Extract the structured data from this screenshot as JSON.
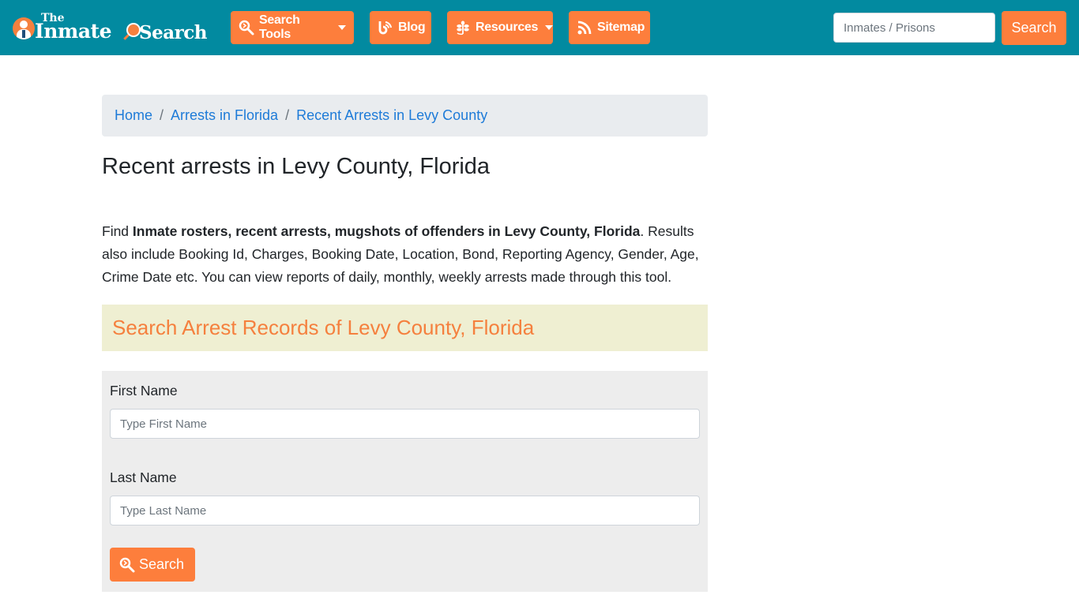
{
  "brand": {
    "logo_the": "The",
    "logo_inmate": "Inmate",
    "logo_search": "Search"
  },
  "nav": {
    "items": [
      {
        "label": "Search Tools",
        "icon": "search-tools-icon",
        "dropdown": true
      },
      {
        "label": "Blog",
        "icon": "blog-icon",
        "dropdown": false
      },
      {
        "label": "Resources",
        "icon": "leaf-icon",
        "dropdown": true
      },
      {
        "label": "Sitemap",
        "icon": "rss-icon",
        "dropdown": false
      }
    ],
    "search_placeholder": "Inmates / Prisons",
    "search_value": "",
    "search_button": "Search"
  },
  "breadcrumb": [
    {
      "label": "Home"
    },
    {
      "label": "Arrests in Florida"
    },
    {
      "label": "Recent Arrests in Levy County"
    }
  ],
  "breadcrumb_separator": "/",
  "page": {
    "title": "Recent arrests in Levy County, Florida",
    "intro_prefix": "Find ",
    "intro_bold": "Inmate rosters, recent arrests, mugshots of offenders in Levy County, Florida",
    "intro_suffix": ". Results also include Booking Id, Charges, Booking Date, Location, Bond, Reporting Agency, Gender, Age, Crime Date etc. You can view reports of daily, monthly, weekly arrests made through this tool."
  },
  "search_section": {
    "heading": "Search Arrest Records of Levy County, Florida",
    "first_name_label": "First Name",
    "first_name_placeholder": "Type First Name",
    "first_name_value": "",
    "last_name_label": "Last Name",
    "last_name_placeholder": "Type Last Name",
    "last_name_value": "",
    "submit_label": "Search"
  },
  "colors": {
    "navbar": "#028aa0",
    "accent": "#fd7e3c",
    "link": "#1e7bd8",
    "section_bg": "#efefd2",
    "form_bg": "#ededed"
  }
}
